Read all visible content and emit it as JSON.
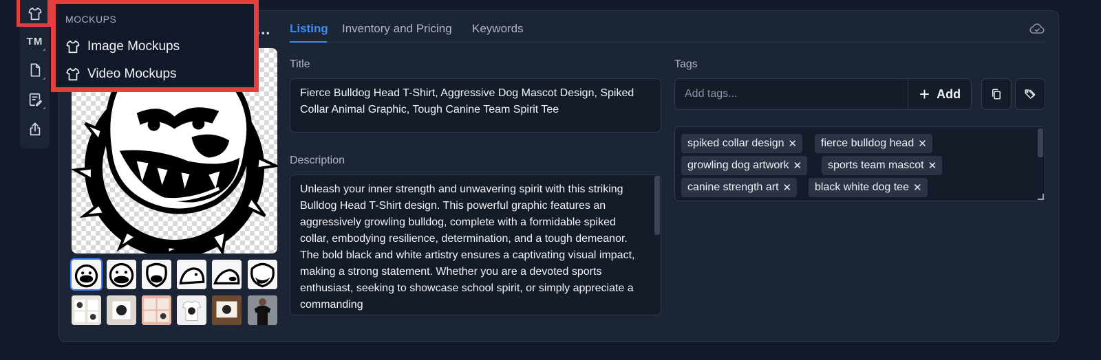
{
  "menu": {
    "heading": "MOCKUPS",
    "items": [
      {
        "label": "Image Mockups",
        "icon": "tshirt-icon"
      },
      {
        "label": "Video Mockups",
        "icon": "tshirt-icon"
      }
    ]
  },
  "toolbar": {
    "tm_label": "TM",
    "icons": [
      "tshirt-icon",
      "trademark-icon",
      "document-icon",
      "edit-note-icon",
      "share-icon"
    ]
  },
  "image_panel": {
    "more_label": "..."
  },
  "tabs": [
    {
      "label": "Listing",
      "active": true
    },
    {
      "label": "Inventory and Pricing",
      "active": false
    },
    {
      "label": "Keywords",
      "active": false
    }
  ],
  "listing": {
    "title_label": "Title",
    "title_value": "Fierce Bulldog Head T-Shirt, Aggressive Dog Mascot Design, Spiked Collar Animal Graphic, Tough Canine Team Spirit Tee",
    "description_label": "Description",
    "description_value": "Unleash your inner strength and unwavering spirit with this striking Bulldog Head T-Shirt design. This powerful graphic features an aggressively growling bulldog, complete with a formidable spiked collar, embodying resilience, determination, and a tough demeanor. The bold black and white artistry ensures a captivating visual impact, making a strong statement. Whether you are a devoted sports enthusiast, seeking to showcase school spirit, or simply appreciate a commanding"
  },
  "tags": {
    "label": "Tags",
    "placeholder": "Add tags...",
    "add_label": "Add",
    "items": [
      "spiked collar design",
      "fierce bulldog head",
      "growling dog artwork",
      "sports team mascot",
      "canine strength art",
      "black white dog tee"
    ]
  },
  "colors": {
    "accent": "#3b8ef5",
    "highlight": "#e53e3e",
    "background": "#121a29",
    "panel": "#1c2535"
  }
}
